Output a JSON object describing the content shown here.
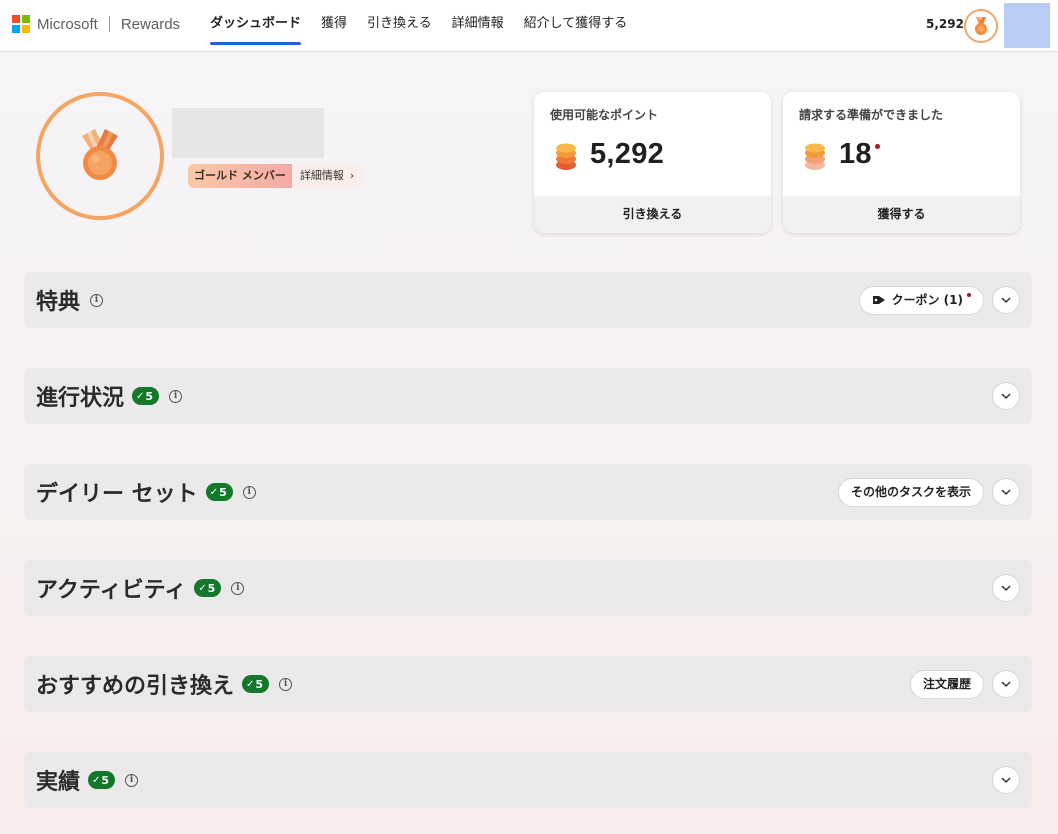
{
  "brand": {
    "name": "Microsoft",
    "product": "Rewards",
    "logo_colors": [
      "#f25022",
      "#7fba00",
      "#00a4ef",
      "#ffb900"
    ]
  },
  "nav": {
    "items": [
      {
        "label": "ダッシュボード",
        "active": true
      },
      {
        "label": "獲得"
      },
      {
        "label": "引き換える"
      },
      {
        "label": "詳細情報"
      },
      {
        "label": "紹介して獲得する"
      }
    ],
    "accent": "#2166c9"
  },
  "header": {
    "points": "5,292",
    "medal_icon": "gold-medal-icon",
    "avatar_color": "#b9ccf5"
  },
  "profile": {
    "tier": "ゴールド メンバー",
    "details_link": "詳細情報",
    "medal_icon": "gold-medal-icon"
  },
  "cards": [
    {
      "title": "使用可能なポイント",
      "value": "5,292",
      "action": "引き換える",
      "icon": "coin-stack-icon"
    },
    {
      "title": "請求する準備ができました",
      "value": "18",
      "action": "獲得する",
      "icon": "coin-stack-icon",
      "has_dot": true
    }
  ],
  "sections": [
    {
      "title": "特典",
      "pill": "クーポン (1)",
      "pill_icon": "tag-icon",
      "pill_dot": true
    },
    {
      "title": "進行状況",
      "badge": "5"
    },
    {
      "title": "デイリー セット",
      "badge": "5",
      "pill": "その他のタスクを表示"
    },
    {
      "title": "アクティビティ",
      "badge": "5"
    },
    {
      "title": "おすすめの引き換え",
      "badge": "5",
      "pill": "注文履歴"
    },
    {
      "title": "実績",
      "badge": "5"
    }
  ],
  "colors": {
    "badge_green": "#12782a",
    "medal_orange": "#f5a561",
    "notification_red": "#b3122a"
  }
}
